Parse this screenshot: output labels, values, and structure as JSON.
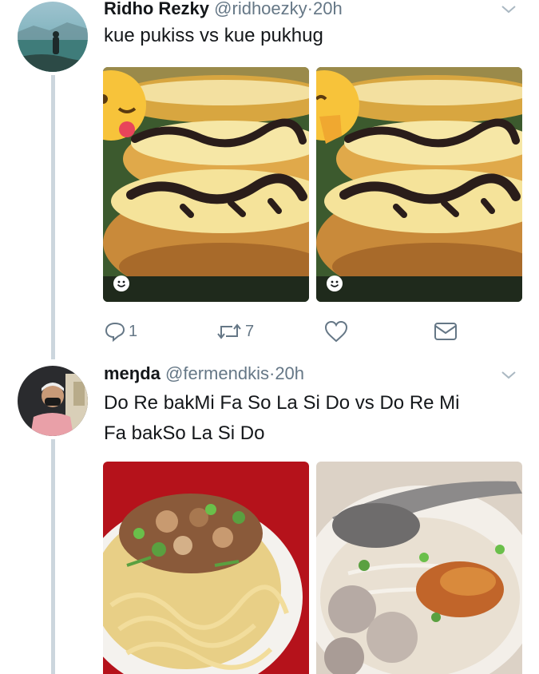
{
  "tweets": [
    {
      "name": "Ridho Rezky",
      "handle": "@ridhoezky",
      "separator": "·",
      "time": "20h",
      "text": "kue pukiss vs kue pukhug",
      "actions": {
        "reply_count": "1",
        "retweet_count": "7"
      }
    },
    {
      "name": "meŋda",
      "handle": "@fermendkis",
      "separator": "·",
      "time": "20h",
      "text_lines": [
        "Do Re bakMi Fa So La Si Do vs Do Re Mi",
        "Fa bakSo La Si Do"
      ]
    }
  ],
  "icons": {
    "more": "chevron-down-icon",
    "reply": "reply-icon",
    "retweet": "retweet-icon",
    "like": "heart-icon",
    "dm": "envelope-icon",
    "media_badge": "smiley-icon"
  },
  "colors": {
    "secondary_text": "#657786",
    "thread_line": "#ccd6dd",
    "icon": "#657786"
  }
}
